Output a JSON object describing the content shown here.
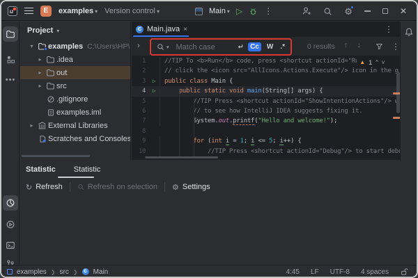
{
  "titlebar": {
    "project_badge": "E",
    "project_name": "examples",
    "vcs_menu": "Version control",
    "run_config": "Main"
  },
  "tool_strip": {
    "left_top_icons": [
      "project-folder",
      "structure",
      "more-tool-windows"
    ],
    "left_bottom_icons": [
      "statistic-pie",
      "services-play",
      "terminal",
      "git-branch"
    ],
    "right_icons": [
      "notifications-bell"
    ]
  },
  "project_panel": {
    "header": "Project",
    "tree": [
      {
        "depth": 0,
        "chev": "open",
        "icon": "folder-root",
        "label": "examples",
        "bold": true,
        "path": "C:\\Users\\HP\\IdeaPro"
      },
      {
        "depth": 1,
        "chev": "closed",
        "icon": "folder",
        "label": ".idea"
      },
      {
        "depth": 1,
        "chev": "closed",
        "icon": "folder",
        "label": "out",
        "selected": true
      },
      {
        "depth": 1,
        "chev": "closed",
        "icon": "folder",
        "label": "src"
      },
      {
        "depth": 1,
        "chev": "none",
        "icon": "gitignore",
        "label": ".gitignore"
      },
      {
        "depth": 1,
        "chev": "none",
        "icon": "iml",
        "label": "examples.iml"
      },
      {
        "depth": 0,
        "chev": "closed",
        "icon": "lib",
        "label": "External Libraries"
      },
      {
        "depth": 0,
        "chev": "none",
        "icon": "scratch",
        "label": "Scratches and Consoles"
      }
    ]
  },
  "editor": {
    "tab": {
      "label": "Main.java",
      "close": "×"
    },
    "search": {
      "placeholder": "Match case",
      "results": "0 results",
      "toggle_case": "Cc",
      "toggle_words": "W",
      "toggle_regex": ".*"
    },
    "inspections": {
      "warning_count": "1"
    },
    "lines": [
      {
        "n": 1,
        "tokens": [
          [
            "com",
            "//TIP To <b>Run</b> code, press <shortcut actionId=\"Run\" "
          ]
        ]
      },
      {
        "n": 2,
        "tokens": [
          [
            "com",
            "// click the <icon src=\"AllIcons.Actions.Execute\"/> icon in the g"
          ]
        ]
      },
      {
        "n": 3,
        "run": true,
        "tokens": [
          [
            "kw",
            "public class "
          ],
          [
            "pl",
            "Main {"
          ]
        ]
      },
      {
        "n": 4,
        "run": true,
        "cur": true,
        "tokens": [
          [
            "pl",
            "    "
          ],
          [
            "kw",
            "public static void "
          ],
          [
            "meth",
            "main"
          ],
          [
            "pl",
            "(String[] args) {"
          ]
        ]
      },
      {
        "n": 5,
        "tokens": [
          [
            "pl",
            "        "
          ],
          [
            "com",
            "//TIP Press <shortcut actionId=\"ShowIntentionActions\"/> wi"
          ]
        ]
      },
      {
        "n": 6,
        "tokens": [
          [
            "pl",
            "        "
          ],
          [
            "com",
            "// to see how IntelliJ IDEA suggests fixing it."
          ]
        ]
      },
      {
        "n": 7,
        "tokens": [
          [
            "pl",
            "        System."
          ],
          [
            "field",
            "out"
          ],
          [
            "pl",
            "."
          ],
          [
            "warn",
            "printf"
          ],
          [
            "pl",
            "("
          ],
          [
            "str",
            "\"Hello and welcome!\""
          ],
          [
            "pl",
            ");"
          ]
        ]
      },
      {
        "n": 8,
        "tokens": []
      },
      {
        "n": 9,
        "tokens": [
          [
            "pl",
            "        "
          ],
          [
            "kw",
            "for"
          ],
          [
            "pl",
            " ("
          ],
          [
            "kw",
            "int"
          ],
          [
            "pl",
            " "
          ],
          [
            "var",
            "i"
          ],
          [
            "pl",
            " = "
          ],
          [
            "num",
            "1"
          ],
          [
            "pl",
            "; "
          ],
          [
            "var",
            "i"
          ],
          [
            "pl",
            " <= "
          ],
          [
            "num",
            "5"
          ],
          [
            "pl",
            "; "
          ],
          [
            "var",
            "i"
          ],
          [
            "pl",
            "++) {"
          ]
        ]
      },
      {
        "n": 10,
        "tokens": [
          [
            "pl",
            "            "
          ],
          [
            "com",
            "//TIP Press <shortcut actionId=\"Debug\"/> to start debu"
          ]
        ]
      }
    ]
  },
  "bottom_panel": {
    "title": "Statistic",
    "tab": "Statistic",
    "actions": [
      {
        "label": "Refresh",
        "enabled": true
      },
      {
        "label": "Refresh on selection",
        "enabled": false
      },
      {
        "label": "Settings",
        "enabled": true
      }
    ]
  },
  "statusbar": {
    "breadcrumb": [
      "examples",
      "src",
      "Main"
    ],
    "caret_position": "4:45",
    "line_ending": "LF",
    "encoding": "UTF-8",
    "indent": "4 spaces"
  },
  "colors": {
    "accent_blue": "#3574F0",
    "annotation_red": "#DD3730",
    "run_green": "#5FAD65",
    "warning_orange": "#E8A14E",
    "selected_row_brown": "#4B3D2F"
  }
}
